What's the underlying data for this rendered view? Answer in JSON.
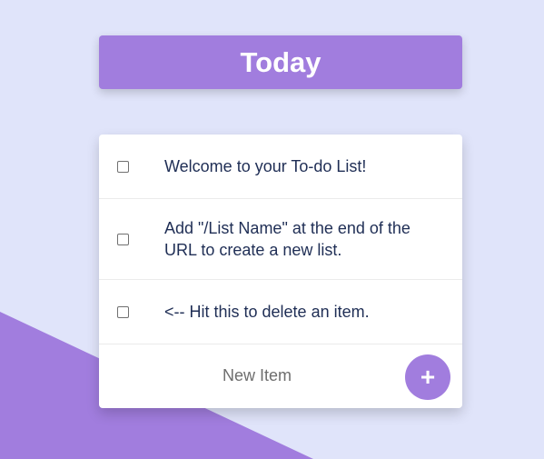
{
  "colors": {
    "background": "#E0E4FA",
    "accent": "#A17DDE",
    "text": "#1F2E55"
  },
  "header": {
    "title": "Today"
  },
  "items": [
    {
      "text": "Welcome to your To-do List!",
      "checked": false
    },
    {
      "text": "Add \"/List Name\" at the end of the URL to create a new list.",
      "checked": false
    },
    {
      "text": "<-- Hit this to delete an item.",
      "checked": false
    }
  ],
  "new_item": {
    "placeholder": "New Item",
    "add_icon": "plus-icon",
    "add_label": "+"
  }
}
